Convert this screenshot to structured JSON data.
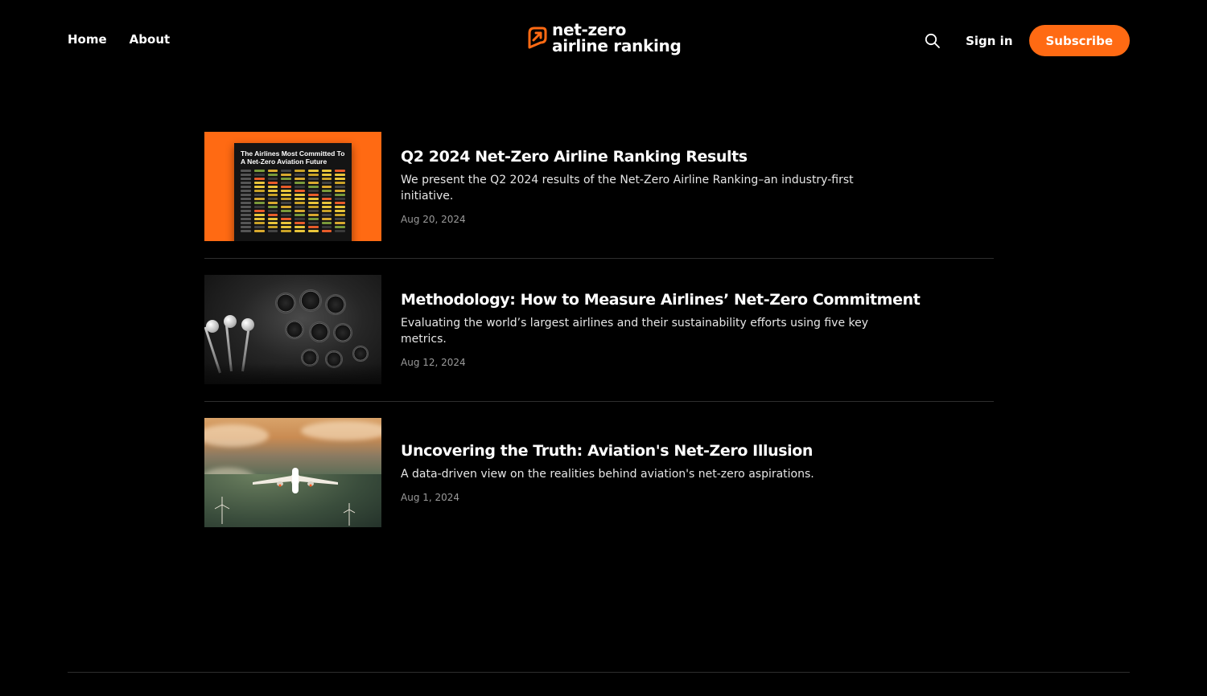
{
  "nav": {
    "home": "Home",
    "about": "About"
  },
  "logo": {
    "line1": "net-zero",
    "line2": "airline ranking",
    "accent_color": "#ff6a13"
  },
  "actions": {
    "search_icon": "search-icon",
    "sign_in": "Sign in",
    "subscribe": "Subscribe"
  },
  "posts": [
    {
      "title": "Q2 2024 Net-Zero Airline Ranking Results",
      "excerpt": "We present the Q2 2024 results of the Net-Zero Airline Ranking–an industry-first initiative.",
      "date": "Aug 20, 2024",
      "thumb_title": "The Airlines Most Committed To A Net-Zero Aviation Future"
    },
    {
      "title": "Methodology: How to Measure Airlines’ Net-Zero Commitment",
      "excerpt": "Evaluating the world’s largest airlines and their sustainability efforts using five key metrics.",
      "date": "Aug 12, 2024"
    },
    {
      "title": "Uncovering the Truth: Aviation's Net-Zero Illusion",
      "excerpt": "A data-driven view on the realities behind aviation's net-zero aspirations.",
      "date": "Aug 1, 2024"
    }
  ]
}
